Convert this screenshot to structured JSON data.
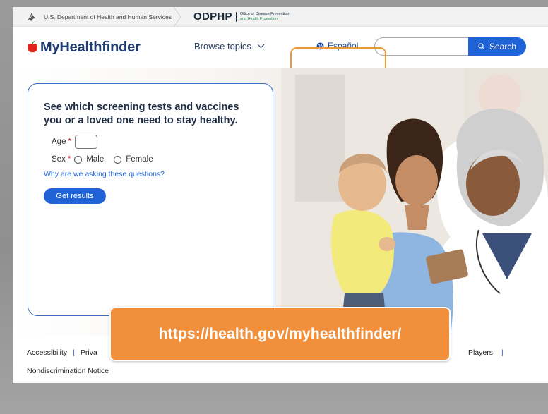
{
  "govbar": {
    "hhs_label": "U.S. Department of Health and Human Services",
    "odphp_word": "ODPHP",
    "odphp_line1": "Office of Disease Prevention",
    "odphp_line2": "and Health Promotion"
  },
  "header": {
    "logo_text": "MyHealthfinder",
    "browse_label": "Browse topics",
    "espanol_label": "Español",
    "search_placeholder": "",
    "search_button": "Search"
  },
  "form": {
    "title": "See which screening tests and vaccines you or a loved one need to stay healthy.",
    "age_label": "Age",
    "required_mark": "*",
    "sex_label": "Sex",
    "male_label": "Male",
    "female_label": "Female",
    "why_link": "Why are we asking these questions?",
    "submit_label": "Get results"
  },
  "footer": {
    "accessibility": "Accessibility",
    "privacy": "Priva",
    "sep": "|",
    "players": "Players",
    "nondiscrimination": "Nondiscrimination Notice"
  },
  "overlay": {
    "url": "https://health.gov/myhealthfinder/"
  },
  "colors": {
    "accent": "#1f63d6",
    "highlight": "#e89a3c",
    "banner": "#f18f3a",
    "brand_navy": "#1f3a6e"
  }
}
